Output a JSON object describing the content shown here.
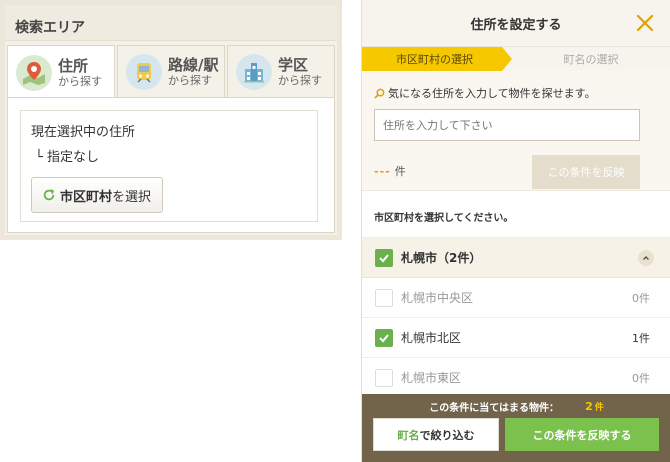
{
  "left_panel": {
    "title": "検索エリア",
    "tabs": [
      {
        "main": "住所",
        "sub": "から探す",
        "icon": "map-pin-icon"
      },
      {
        "main": "路線/駅",
        "sub": "から探す",
        "icon": "train-icon"
      },
      {
        "main": "学区",
        "sub": "から探す",
        "icon": "school-building-icon"
      }
    ],
    "current_label": "現在選択中の住所",
    "current_value": "└ 指定なし",
    "city_button_bold": "市区町村",
    "city_button_rest": "を選択"
  },
  "modal": {
    "title": "住所を設定する",
    "steps": [
      "市区町村の選択",
      "町名の選択"
    ],
    "hint": "気になる住所を入力して物件を探せます。",
    "input_placeholder": "住所を入力して下さい",
    "count_dash": "---",
    "count_unit": "件",
    "reflect_small_label": "この条件を反映",
    "instruction": "市区町村を選択してください。",
    "city": {
      "name": "札幌市（2件）",
      "checked": true
    },
    "wards": [
      {
        "name": "札幌市中央区",
        "count": "0件",
        "checked": false
      },
      {
        "name": "札幌市北区",
        "count": "1件",
        "checked": true
      },
      {
        "name": "札幌市東区",
        "count": "0件",
        "checked": false
      }
    ],
    "footer": {
      "match_label": "この条件に当てはまる物件：",
      "match_count": "2",
      "match_unit": "件",
      "narrow_em": "町名",
      "narrow_rest": "で絞り込む",
      "apply_label": "この条件を反映する"
    }
  },
  "colors": {
    "accent_yellow": "#f5c800",
    "check_green": "#6ab04c",
    "apply_green": "#7cc04e",
    "footer_brown": "#66563c"
  }
}
